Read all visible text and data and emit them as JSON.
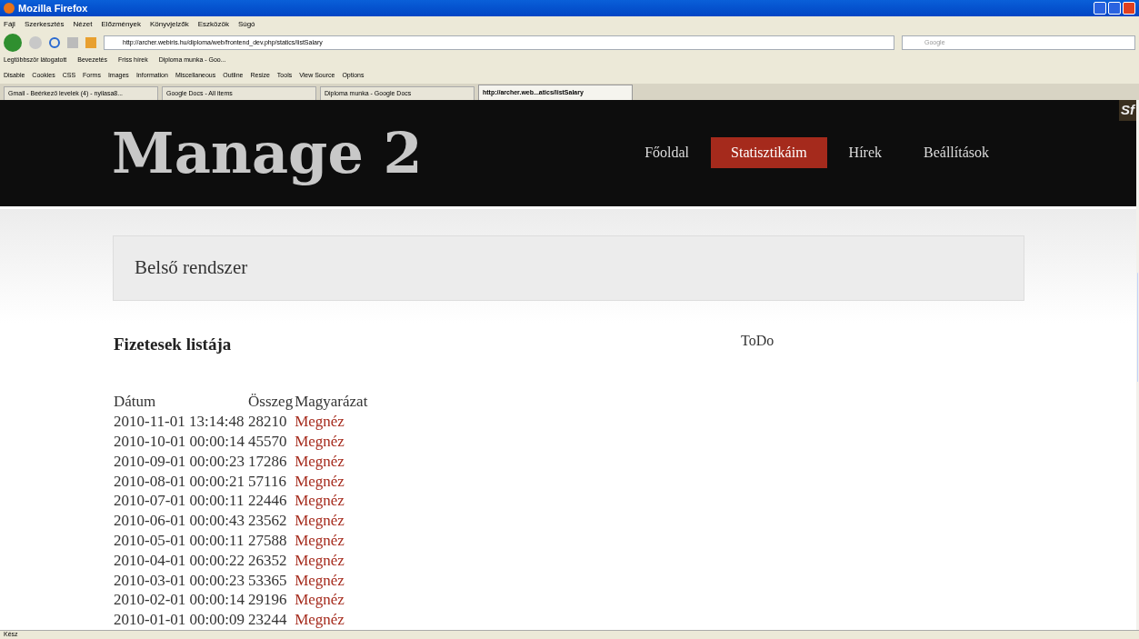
{
  "window": {
    "title": "Mozilla Firefox"
  },
  "menu": [
    "Fájl",
    "Szerkesztés",
    "Nézet",
    "Előzmények",
    "Könyvjelzők",
    "Eszközök",
    "Súgó"
  ],
  "address": {
    "value": "http://archer.webiris.hu/diploma/web/frontend_dev.php/statics/listSalary"
  },
  "search": {
    "placeholder": "Google"
  },
  "bookmarks": [
    "Legtöbbször látogatott",
    "Bevezetés",
    "Friss hírek",
    "Diploma munka - Goo..."
  ],
  "dev_toolbar": [
    "Disable",
    "Cookies",
    "CSS",
    "Forms",
    "Images",
    "Information",
    "Miscellaneous",
    "Outline",
    "Resize",
    "Tools",
    "View Source",
    "Options"
  ],
  "tabs": [
    {
      "label": "Gmail - Beérkező levelek (4) - nyilasa8...",
      "selected": false
    },
    {
      "label": "Google Docs - All items",
      "selected": false
    },
    {
      "label": "Diploma munka - Google Docs",
      "selected": false
    },
    {
      "label": "http://archer.web...atics/listSalary",
      "selected": true
    }
  ],
  "site": {
    "logo": "Manage 2",
    "badge": "Sf",
    "nav": [
      {
        "label": "Főoldal",
        "selected": false
      },
      {
        "label": "Statisztikáim",
        "selected": true
      },
      {
        "label": "Hírek",
        "selected": false
      },
      {
        "label": "Beállítások",
        "selected": false
      }
    ],
    "banner": "Belső rendszer",
    "heading": "Fizetesek listája",
    "side": "ToDo"
  },
  "table": {
    "columns": [
      "Dátum",
      "Összeg",
      "Magyarázat"
    ],
    "rows": [
      [
        "2010-11-01 13:14:48",
        "28210",
        "Megnéz"
      ],
      [
        "2010-10-01 00:00:14",
        "45570",
        "Megnéz"
      ],
      [
        "2010-09-01 00:00:23",
        "17286",
        "Megnéz"
      ],
      [
        "2010-08-01 00:00:21",
        "57116",
        "Megnéz"
      ],
      [
        "2010-07-01 00:00:11",
        "22446",
        "Megnéz"
      ],
      [
        "2010-06-01 00:00:43",
        "23562",
        "Megnéz"
      ],
      [
        "2010-05-01 00:00:11",
        "27588",
        "Megnéz"
      ],
      [
        "2010-04-01 00:00:22",
        "26352",
        "Megnéz"
      ],
      [
        "2010-03-01 00:00:23",
        "53365",
        "Megnéz"
      ],
      [
        "2010-02-01 00:00:14",
        "29196",
        "Megnéz"
      ],
      [
        "2010-01-01 00:00:09",
        "23244",
        "Megnéz"
      ]
    ]
  },
  "status_bar": "Kész"
}
